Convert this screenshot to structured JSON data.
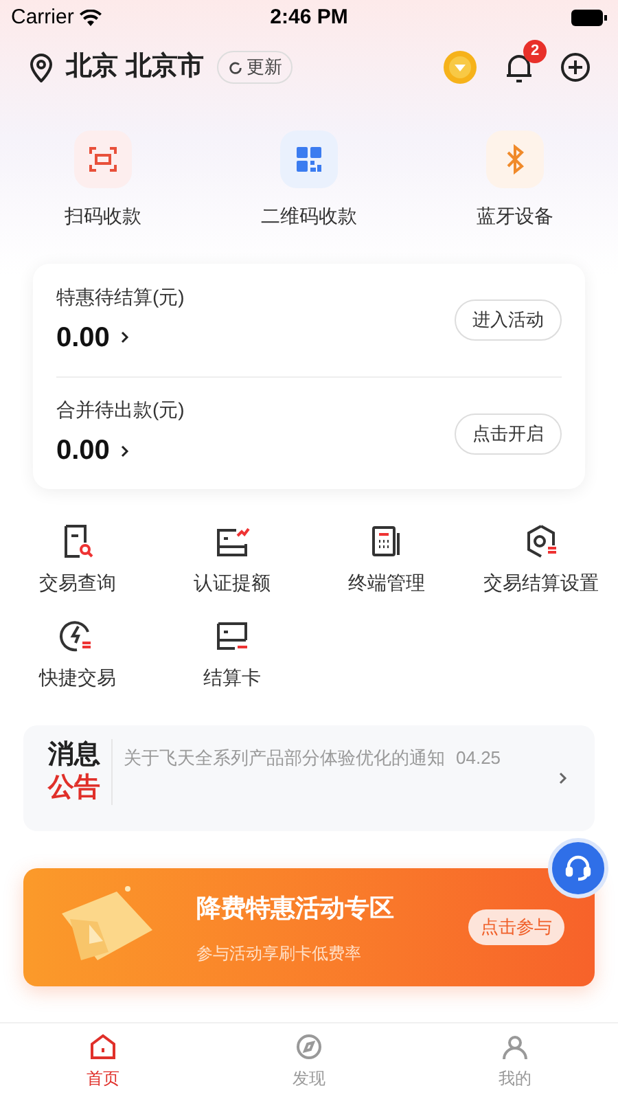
{
  "status_bar": {
    "carrier": "Carrier",
    "time": "2:46 PM"
  },
  "header": {
    "location": "北京 北京市",
    "refresh": "更新",
    "notifications": "2"
  },
  "quick_actions": [
    {
      "label": "扫码收款",
      "kind": "scan"
    },
    {
      "label": "二维码收款",
      "kind": "qr"
    },
    {
      "label": "蓝牙设备",
      "kind": "bluetooth"
    }
  ],
  "balances": [
    {
      "title": "特惠待结算(元)",
      "amount": "0.00",
      "action": "进入活动"
    },
    {
      "title": "合并待出款(元)",
      "amount": "0.00",
      "action": "点击开启"
    }
  ],
  "services": [
    {
      "label": "交易查询",
      "kind": "query"
    },
    {
      "label": "认证提额",
      "kind": "raise"
    },
    {
      "label": "终端管理",
      "kind": "terminal"
    },
    {
      "label": "交易结算设置",
      "kind": "settings"
    },
    {
      "label": "快捷交易",
      "kind": "quick"
    },
    {
      "label": "结算卡",
      "kind": "card"
    }
  ],
  "notice": {
    "badge_top": "消息",
    "badge_bottom": "公告",
    "text": "关于飞天全系列产品部分体验优化的通知",
    "date": "04.25"
  },
  "banner": {
    "title": "降费特惠活动专区",
    "subtitle": "参与活动享刷卡低费率",
    "button": "点击参与"
  },
  "tabs": [
    {
      "label": "首页",
      "selected": true
    },
    {
      "label": "发现",
      "selected": false
    },
    {
      "label": "我的",
      "selected": false
    }
  ]
}
